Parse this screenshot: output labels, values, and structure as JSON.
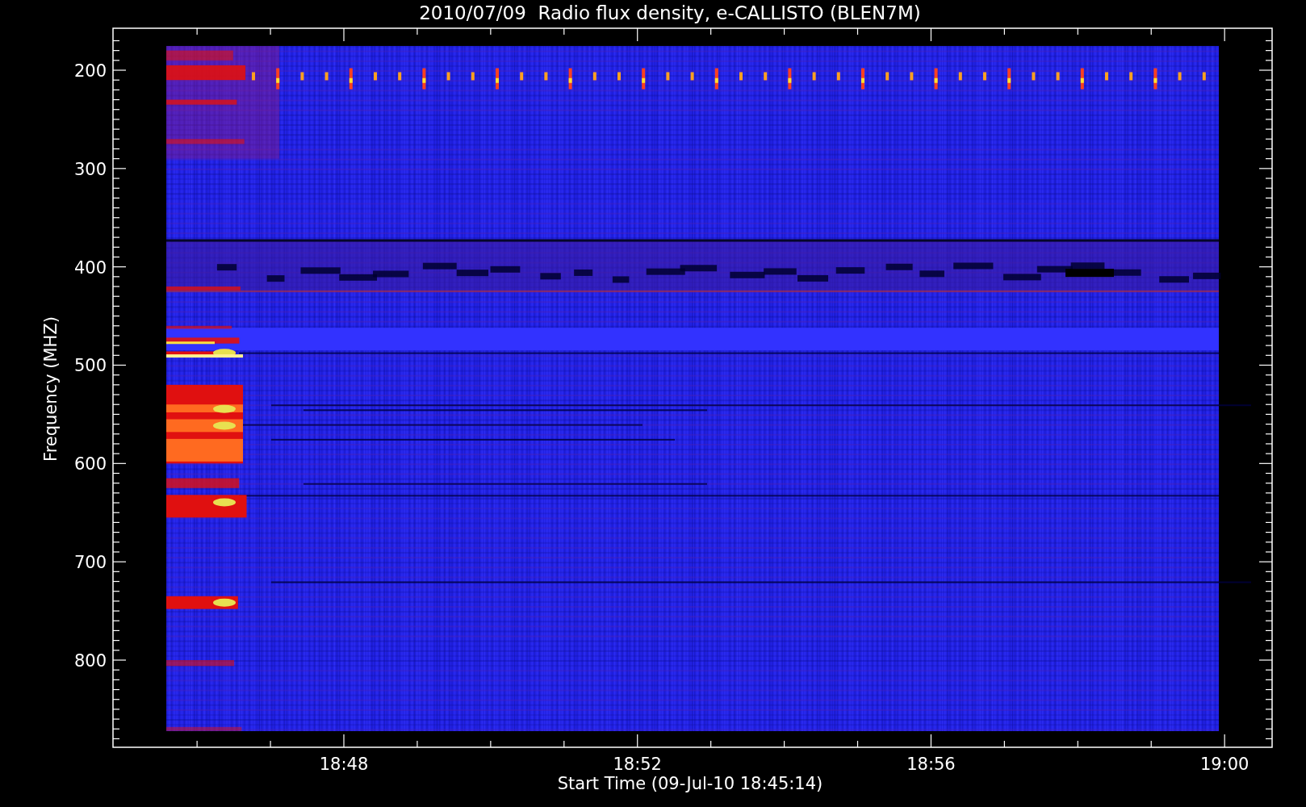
{
  "title": "2010/07/09  Radio flux density, e-CALLISTO (BLEN7M)",
  "y_axis": {
    "label": "Frequency (MHZ)",
    "ticks": [
      "200",
      "300",
      "400",
      "500",
      "600",
      "700",
      "800"
    ]
  },
  "x_axis": {
    "label": "Start Time (09-Jul-10 18:45:14)",
    "ticks": [
      "18:48",
      "18:52",
      "18:56",
      "19:00"
    ]
  }
}
